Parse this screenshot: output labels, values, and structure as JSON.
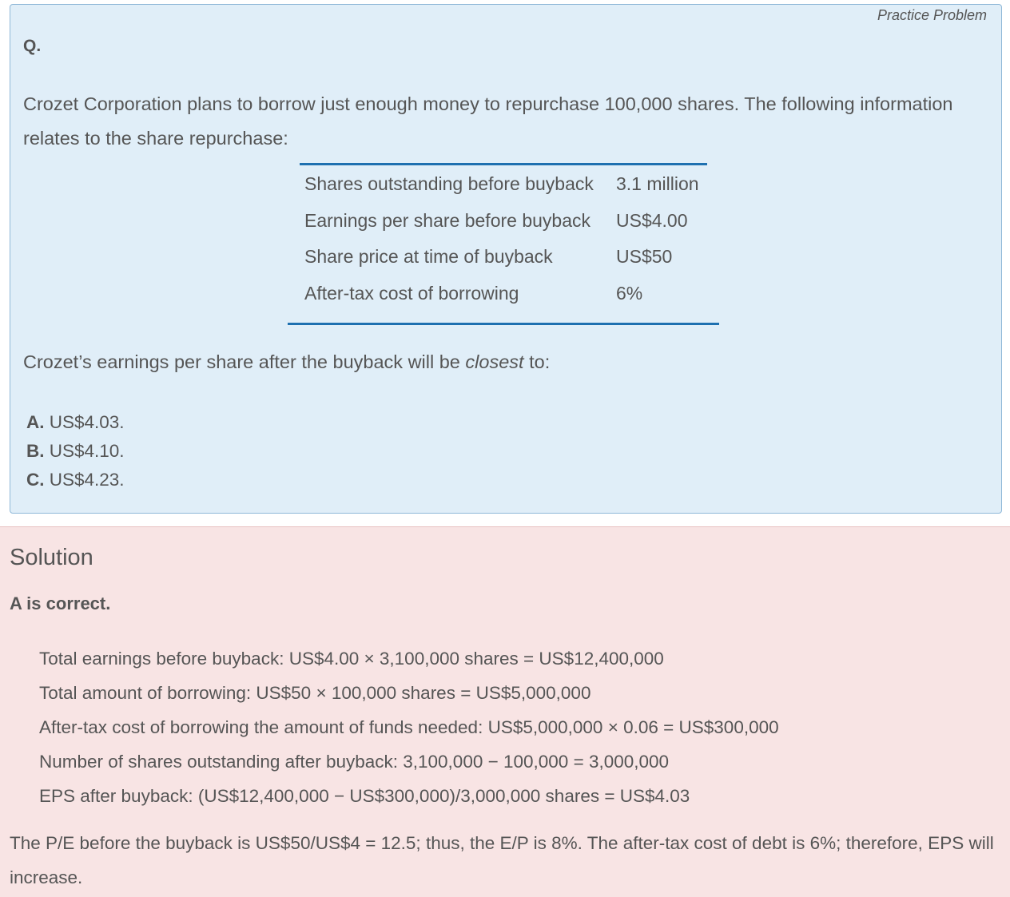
{
  "problem": {
    "tag": "Practice Problem",
    "q_label": "Q.",
    "stem": "Crozet Corporation plans to borrow just enough money to repurchase 100,000 shares. The following information relates to the share repurchase:",
    "table": [
      {
        "label": "Shares outstanding before buyback",
        "value": "3.1 million"
      },
      {
        "label": "Earnings per share before buyback",
        "value": "US$4.00"
      },
      {
        "label": "Share price at time of buyback",
        "value": "US$50"
      },
      {
        "label": "After-tax cost of borrowing",
        "value": "6%"
      }
    ],
    "question_prefix": "Crozet’s earnings per share after the buyback will be ",
    "question_emph": "closest",
    "question_suffix": " to:",
    "options": [
      {
        "letter": "A.",
        "text": " US$4.03."
      },
      {
        "letter": "B.",
        "text": " US$4.10."
      },
      {
        "letter": "C.",
        "text": " US$4.23."
      }
    ]
  },
  "solution": {
    "title": "Solution",
    "correct": "A is correct.",
    "steps": [
      "Total earnings before buyback: US$4.00 × 3,100,000 shares = US$12,400,000",
      "Total amount of borrowing: US$50 × 100,000 shares = US$5,000,000",
      "After-tax cost of borrowing the amount of funds needed: US$5,000,000 × 0.06 = US$300,000",
      "Number of shares outstanding after buyback: 3,100,000 − 100,000 = 3,000,000",
      "EPS after buyback: (US$12,400,000 − US$300,000)/3,000,000 shares = US$4.03"
    ],
    "note": "The P/E before the buyback is US$50/US$4 = 12.5; thus, the E/P is 8%. The after-tax cost of debt is 6%; therefore, EPS will increase."
  }
}
